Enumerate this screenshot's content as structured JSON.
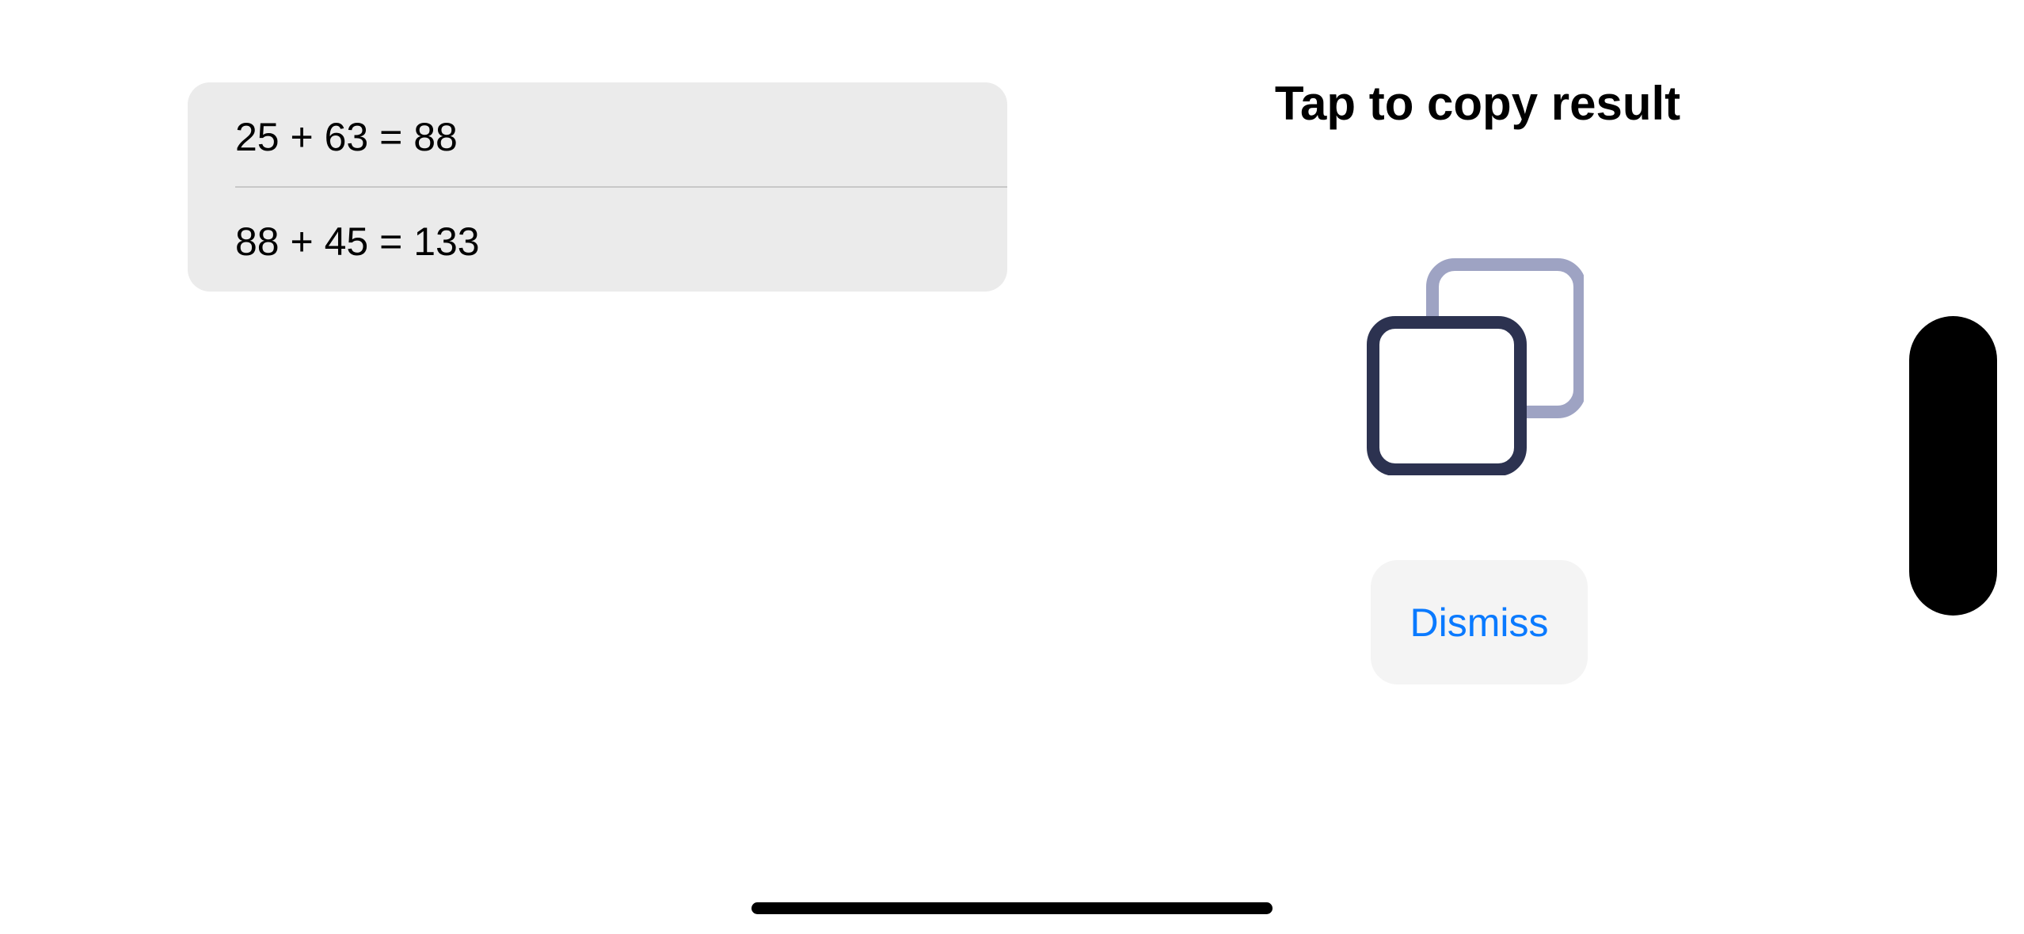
{
  "history": {
    "items": [
      {
        "expression": "25 + 63 = 88"
      },
      {
        "expression": "88 + 45 = 133"
      }
    ]
  },
  "copy_panel": {
    "title": "Tap to copy result",
    "icon": "copy-icon",
    "dismiss_label": "Dismiss"
  },
  "colors": {
    "accent": "#0a7aff",
    "icon_front": "#2c3250",
    "icon_back": "#9ea3c3",
    "card_bg": "#ebebeb"
  }
}
